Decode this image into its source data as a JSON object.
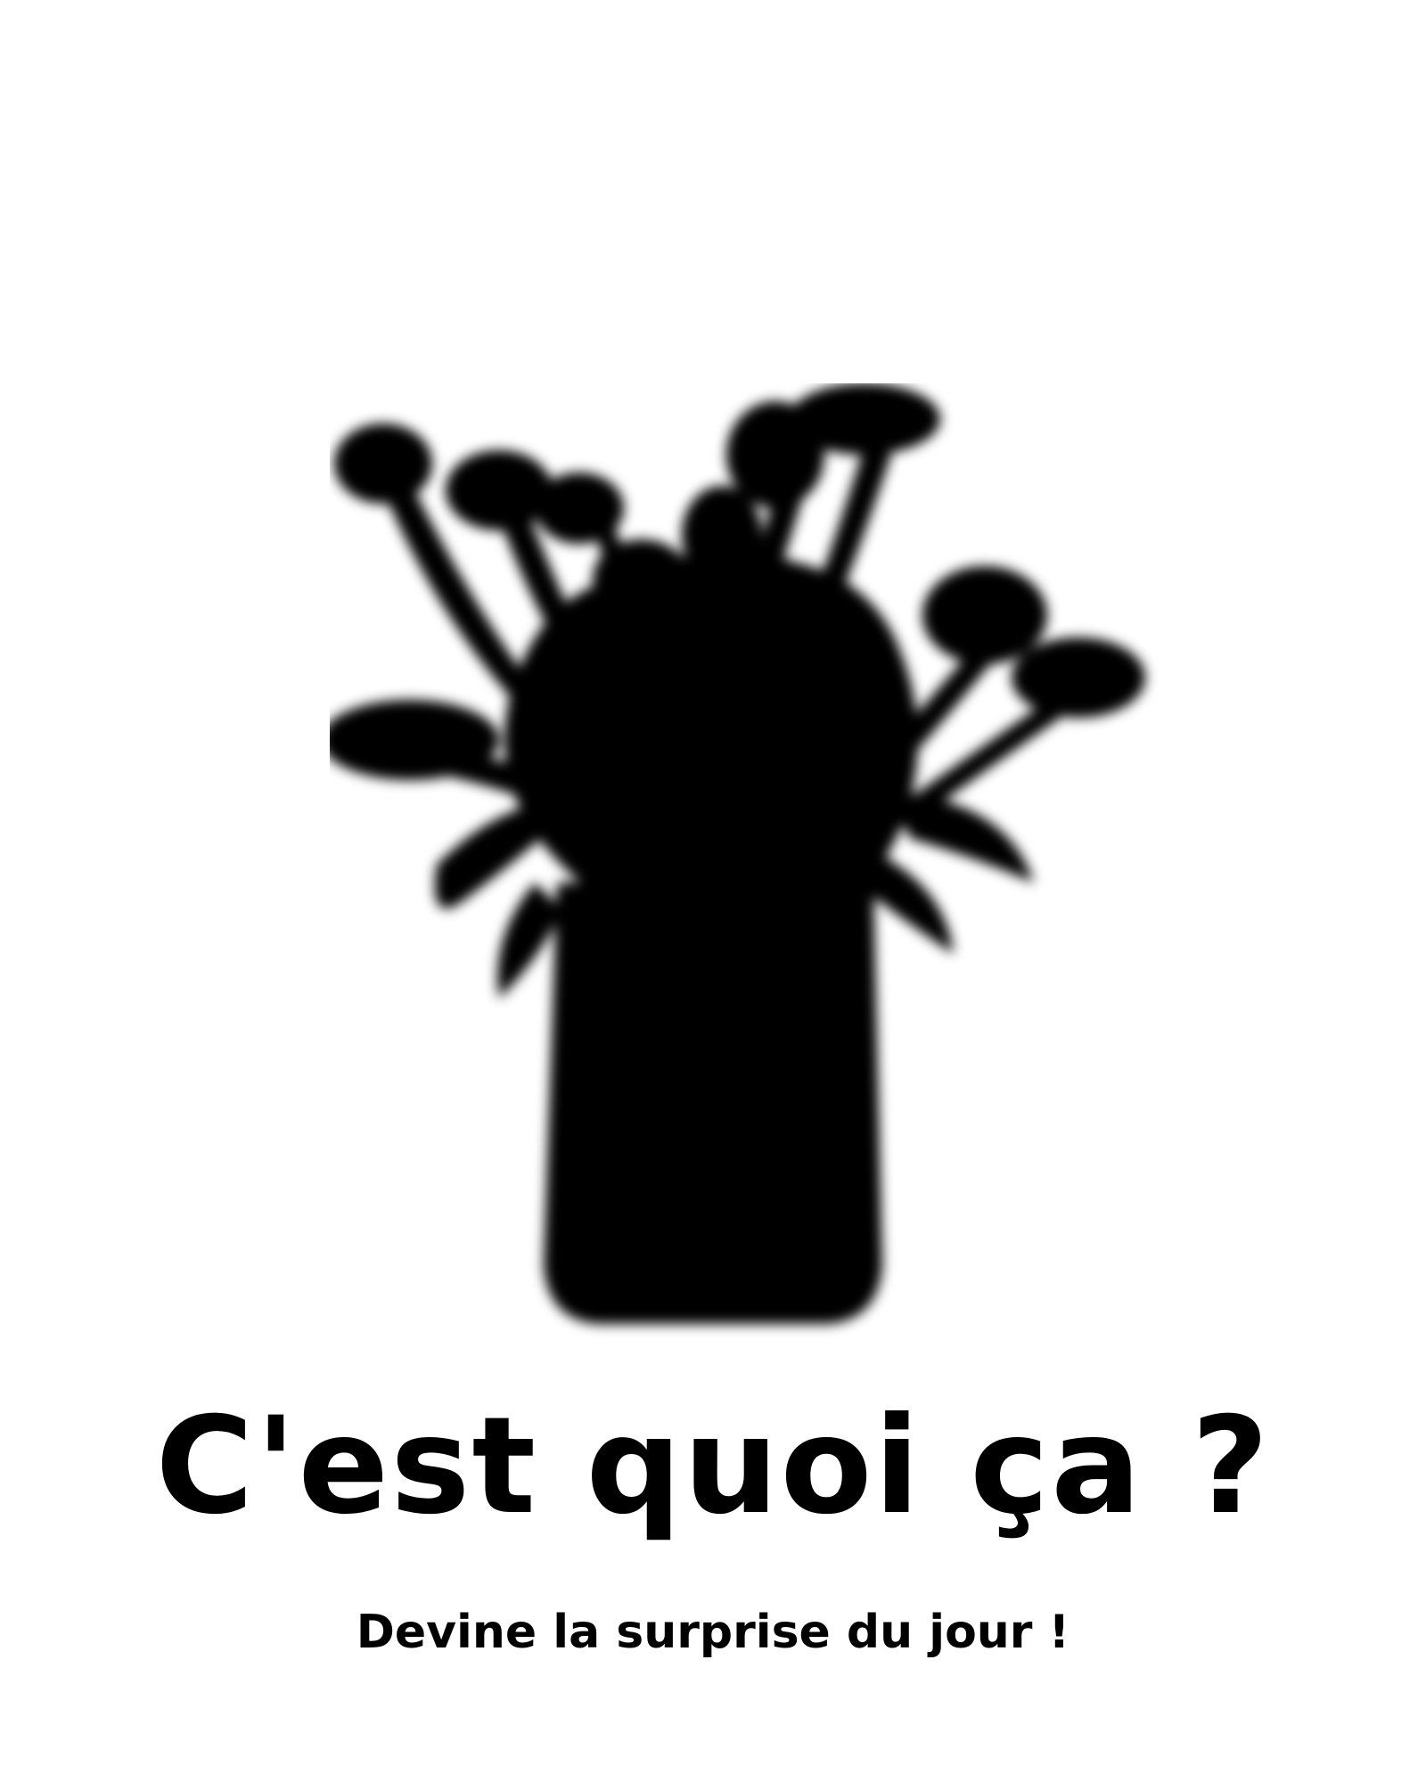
{
  "poster": {
    "image_subject": "mystery-bouquet-silhouette",
    "headline": "C'est quoi ça ?",
    "subheadline": "Devine la surprise du jour !"
  },
  "colors": {
    "background": "#ffffff",
    "ink": "#000000"
  }
}
